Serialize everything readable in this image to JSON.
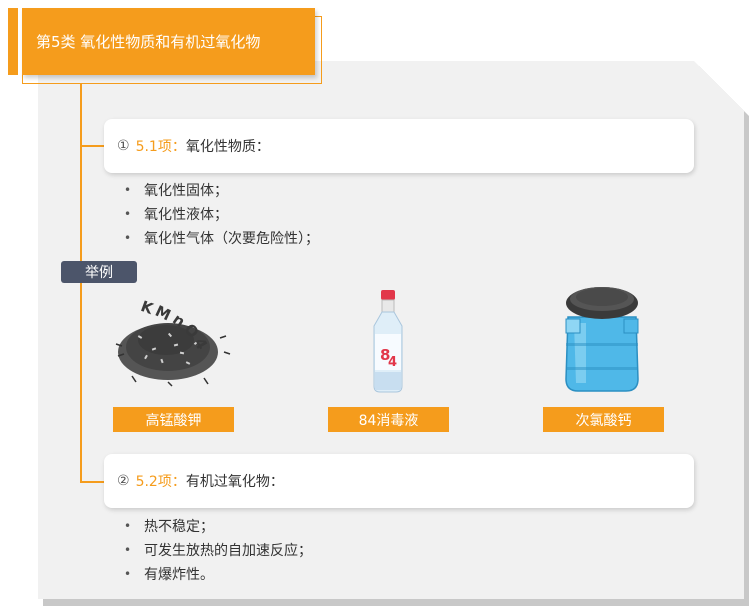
{
  "header": {
    "title": "第5类 氧化性物质和有机过氧化物"
  },
  "sections": [
    {
      "number": "①",
      "code": "5.1项：",
      "name": "氧化性物质：",
      "bullets": [
        "氧化性固体；",
        "氧化性液体；",
        "氧化性气体（次要危险性）；"
      ]
    },
    {
      "number": "②",
      "code": "5.2项：",
      "name": "有机过氧化物：",
      "bullets": [
        "热不稳定；",
        "可发生放热的自加速反应；",
        "有爆炸性。"
      ]
    }
  ],
  "examples": {
    "tag": "举例",
    "items": [
      {
        "label": "高锰酸钾",
        "image_text": "KMnO4",
        "icon": "potassium-permanganate-pile-icon"
      },
      {
        "label": "84消毒液",
        "image_text": "84",
        "icon": "disinfectant-bottle-icon"
      },
      {
        "label": "次氯酸钙",
        "image_text": "",
        "icon": "calcium-hypochlorite-drum-icon"
      }
    ]
  },
  "colors": {
    "accent": "#f59c1c",
    "tag_bg": "#4c556a",
    "panel_bg": "#f1f1f1"
  }
}
